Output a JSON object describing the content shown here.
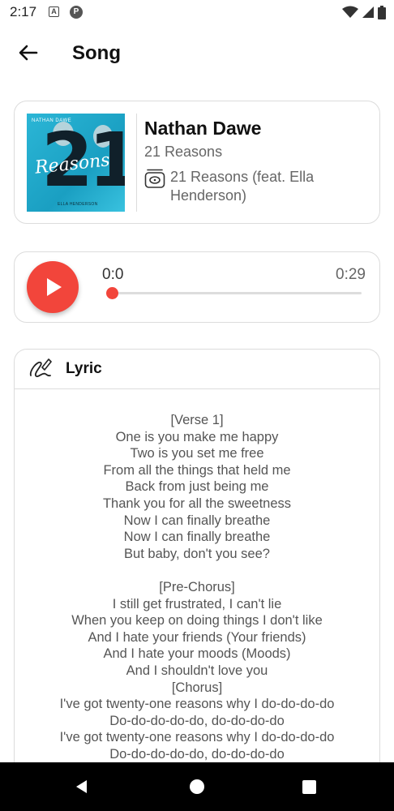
{
  "status_bar": {
    "time": "2:17",
    "notif_a": "A",
    "notif_p": "P"
  },
  "app_bar": {
    "title": "Song"
  },
  "song": {
    "artist": "Nathan Dawe",
    "album": "21 Reasons",
    "track": "21 Reasons (feat. Ella Henderson)",
    "cover": {
      "number": "21",
      "script": "Reasons",
      "top_text": "NATHAN DAWE",
      "bottom_text": "ELLA HENDERSON"
    }
  },
  "player": {
    "current_time": "0:0",
    "total_time": "0:29",
    "progress": 0
  },
  "lyric": {
    "title": "Lyric",
    "lines": [
      "[Verse 1]",
      "One is you make me happy",
      "Two is you set me free",
      "From all the things that held me",
      "Back from just being me",
      "Thank you for all the sweetness",
      "Now I can finally breathe",
      "Now I can finally breathe",
      "But baby, don't you see?",
      "",
      "[Pre-Chorus]",
      "I still get frustrated, I can't lie",
      "When you keep on doing things I don't like",
      "And I hate your friends (Your friends)",
      "And I hate your moods (Moods)",
      "And I shouldn't love you",
      "[Chorus]",
      "I've got twenty-one reasons why I do-do-do-do",
      "Do-do-do-do-do, do-do-do-do",
      "I've got twenty-one reasons why I do-do-do-do",
      "Do-do-do-do-do, do-do-do-do"
    ]
  },
  "colors": {
    "accent": "#f2453b",
    "border": "#dcdcdc",
    "nav_bg": "#000000"
  },
  "icons": {
    "back": "arrow-left-icon",
    "track": "disc-icon",
    "lyric": "signature-pen-icon",
    "play": "play-icon",
    "wifi": "wifi-icon",
    "signal": "signal-icon",
    "battery": "battery-icon"
  }
}
